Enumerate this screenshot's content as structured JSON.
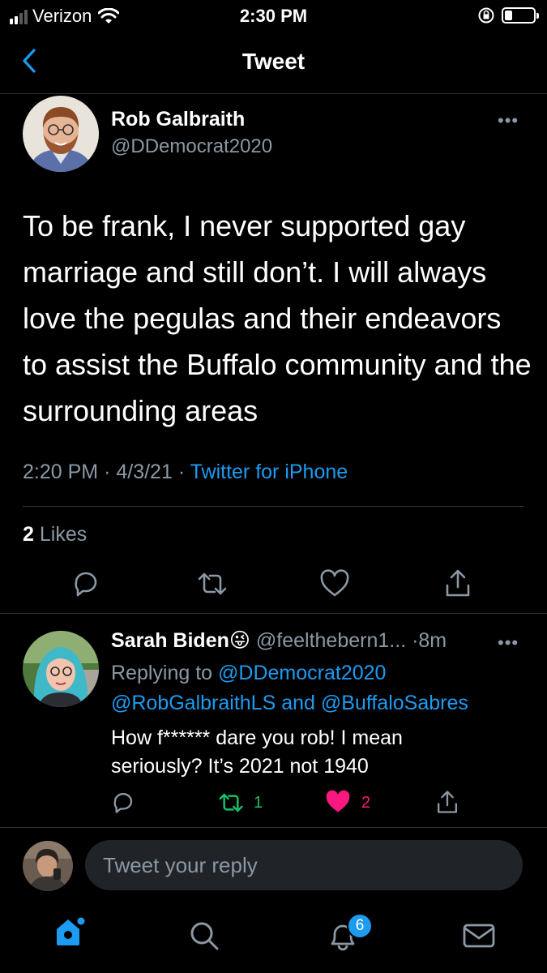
{
  "status_bar": {
    "carrier": "Verizon",
    "time": "2:30 PM"
  },
  "nav": {
    "title": "Tweet"
  },
  "tweet": {
    "author_name": "Rob Galbraith",
    "author_handle": "@DDemocrat2020",
    "text": "To be frank, I never supported gay marriage and still don’t. I will always love the pegulas and their endeavors to assist the Buffalo community and the surrounding areas",
    "time": "2:20 PM",
    "date": "4/3/21",
    "source": "Twitter for iPhone",
    "likes_count": "2",
    "likes_label": "Likes"
  },
  "reply": {
    "author_name": "Sarah Biden",
    "author_emoji": "😜",
    "author_handle": "@feelthebern1...",
    "time": "8m",
    "replying_to_label": "Replying to",
    "replying_to_1": "@DDemocrat2020",
    "replying_to_2": "@RobGalbraithLS",
    "replying_and": "and",
    "replying_to_3": "@BuffaloSabres",
    "text": "How f****** dare you rob! I mean seriously? It’s 2021 not 1940",
    "retweet_count": "1",
    "like_count": "2"
  },
  "composer": {
    "placeholder": "Tweet your reply"
  },
  "tab_bar": {
    "notifications_badge": "6"
  },
  "colors": {
    "background": "#000000",
    "accent": "#1d9bf0",
    "secondary_text": "#8b98a5",
    "retweet_green": "#17bf63",
    "like_red": "#f91880"
  }
}
